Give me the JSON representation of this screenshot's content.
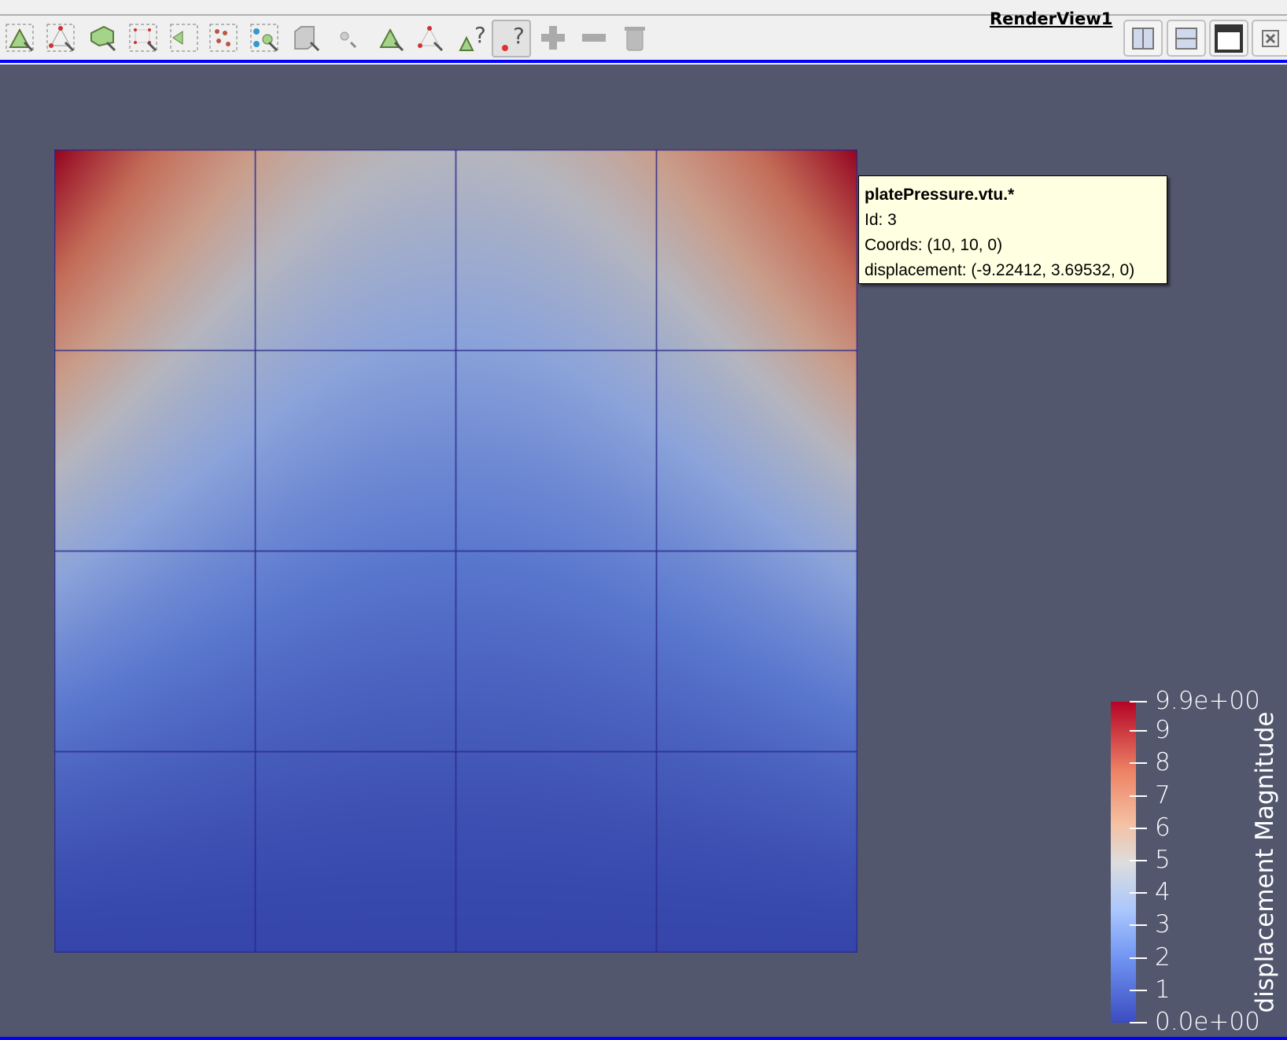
{
  "toolbar": {
    "icons": [
      "select-cells-on-icon",
      "select-points-on-icon",
      "select-cells-frustum-icon",
      "select-points-frustum-icon",
      "select-cells-polygon-icon",
      "select-points-polygon-icon",
      "select-blocks-icon",
      "interactive-select-cells-icon",
      "interactive-select-points-icon",
      "hover-points-icon",
      "hover-cells-icon",
      "hover-cell-query-icon",
      "hover-point-query-icon",
      "grow-selection-icon",
      "shrink-selection-icon",
      "clear-selection-icon"
    ],
    "view_name": "RenderView1",
    "layout_buttons": [
      "split-horizontal-icon",
      "split-vertical-icon",
      "maximize-icon",
      "close-view-icon"
    ]
  },
  "tooltip": {
    "title": "platePressure.vtu.*",
    "id": "Id: 3",
    "coords": "Coords: (10, 10, 0)",
    "displacement": "displacement: (-9.22412, 3.69532, 0)"
  },
  "colorbar": {
    "title": "displacement Magnitude",
    "range": [
      0,
      9.9
    ],
    "labels": [
      "9.9e+00",
      "9",
      "8",
      "7",
      "6",
      "5",
      "4",
      "3",
      "2",
      "1",
      "0.0e+00"
    ],
    "colors": {
      "low": "#3b4cc0",
      "mid": "#dddddd",
      "high": "#b40426"
    }
  },
  "colors": {
    "background": "#52576e",
    "active_border": "#0000ff"
  }
}
